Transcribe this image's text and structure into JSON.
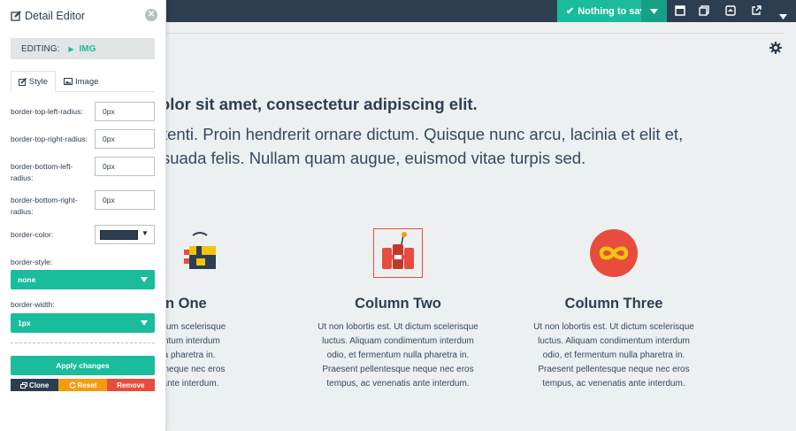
{
  "topbar": {
    "save_label": "Nothing to save",
    "icons": [
      "window-icon",
      "duplicate-icon",
      "export-icon",
      "external-link-icon",
      "caret-down-icon"
    ]
  },
  "content": {
    "heading": "m dolor sit amet, consectetur adipiscing elit.",
    "para_line1": "e potenti. Proin hendrerit ornare dictum. Quisque nunc arcu, lacinia et elit et,",
    "para_line2": "nalesuada felis. Nullam quam augue, euismod vitae turpis sed.",
    "columns": [
      {
        "title": "umn One",
        "lines": [
          "est. Ut dictum scelerisque",
          "condimentum interdum",
          "um nulla pharetra in.",
          "entesque neque nec eros",
          "nenatis ante interdum."
        ]
      },
      {
        "title": "Column Two",
        "lines": [
          "Ut non lobortis est. Ut dictum scelerisque",
          "luctus. Aliquam condimentum interdum",
          "odio, et fermentum nulla pharetra in.",
          "Praesent pellentesque neque nec eros",
          "tempus, ac venenatis ante interdum."
        ]
      },
      {
        "title": "Column Three",
        "lines": [
          "Ut non lobortis est. Ut dictum scelerisque",
          "luctus. Aliquam condimentum interdum",
          "odio, et fermentum nulla pharetra in.",
          "Praesent pellentesque neque nec eros",
          "tempus, ac venenatis ante interdum."
        ]
      }
    ]
  },
  "panel": {
    "title": "Detail Editor",
    "editing_label": "EDITING:",
    "editing_tag": "IMG",
    "tabs": {
      "style": "Style",
      "image": "Image"
    },
    "fields": {
      "tl_label": "border-top-left-radius:",
      "tl_value": "0px",
      "tr_label": "border-top-right-radius:",
      "tr_value": "0px",
      "bl_label": "border-bottom-left-radius:",
      "bl_value": "0px",
      "br_label": "border-bottom-right-radius:",
      "br_value": "0px",
      "color_label": "border-color:",
      "color_value": "#2c3e50",
      "style_label": "border-style:",
      "style_value": "none",
      "width_label": "border-width:",
      "width_value": "1px"
    },
    "buttons": {
      "apply": "Apply changes",
      "clone": "Clone",
      "reset": "Reset",
      "remove": "Remove"
    }
  },
  "colors": {
    "accent": "#1abc9c",
    "navy": "#2c3e50",
    "orange": "#f39c12",
    "red": "#e74c3c"
  }
}
